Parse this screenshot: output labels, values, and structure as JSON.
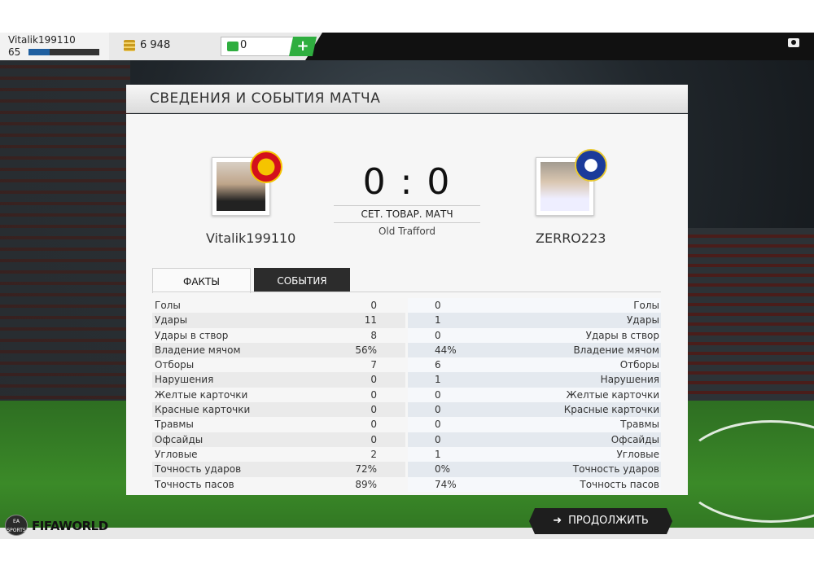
{
  "topbar": {
    "username": "Vitalik199110",
    "level": "65",
    "xp_fraction": 0.3,
    "coins": "6 948",
    "points": "0",
    "add_label": "+"
  },
  "panel": {
    "title": "СВЕДЕНИЯ И СОБЫТИЯ МАТЧА",
    "home_name": "Vitalik199110",
    "away_name": "ZERRO223",
    "score": "0 : 0",
    "match_type": "СЕТ. ТОВАР. МАТЧ",
    "stadium": "Old Trafford"
  },
  "tabs": {
    "facts": "ФАКТЫ",
    "events": "СОБЫТИЯ"
  },
  "stats": [
    {
      "label": "Голы",
      "home": "0",
      "away": "0"
    },
    {
      "label": "Удары",
      "home": "11",
      "away": "1"
    },
    {
      "label": "Удары в створ",
      "home": "8",
      "away": "0"
    },
    {
      "label": "Владение мячом",
      "home": "56%",
      "away": "44%"
    },
    {
      "label": "Отборы",
      "home": "7",
      "away": "6"
    },
    {
      "label": "Нарушения",
      "home": "0",
      "away": "1"
    },
    {
      "label": "Желтые карточки",
      "home": "0",
      "away": "0"
    },
    {
      "label": "Красные карточки",
      "home": "0",
      "away": "0"
    },
    {
      "label": "Травмы",
      "home": "0",
      "away": "0"
    },
    {
      "label": "Офсайды",
      "home": "0",
      "away": "0"
    },
    {
      "label": "Угловые",
      "home": "2",
      "away": "1"
    },
    {
      "label": "Точность ударов",
      "home": "72%",
      "away": "0%"
    },
    {
      "label": "Точность пасов",
      "home": "89%",
      "away": "74%"
    }
  ],
  "footer": {
    "continue_label": "ПРОДОЛЖИТЬ",
    "ea_badge": "EA SPORTS",
    "logo": "FIFAWORLD"
  }
}
